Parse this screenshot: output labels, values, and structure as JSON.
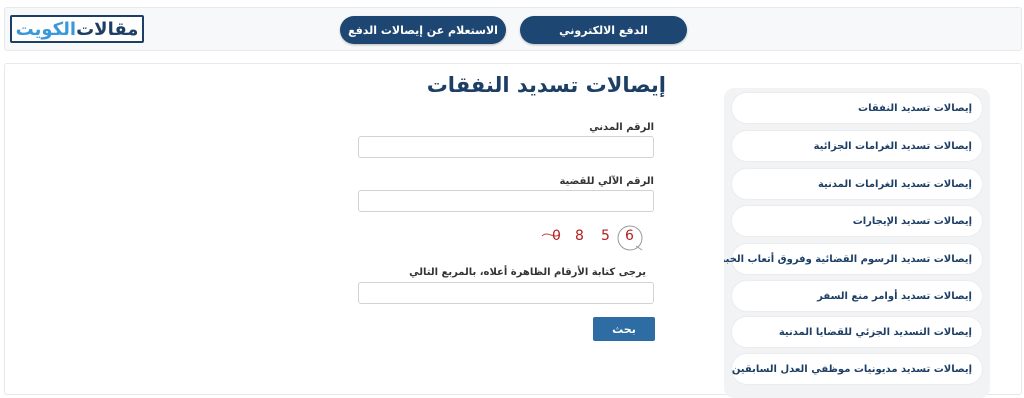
{
  "logo": {
    "part1": "مقالات",
    "part2": "الكويت"
  },
  "top_nav": {
    "inquiry_label": "الاستعلام عن إيصالات الدفع",
    "payment_label": "الدفع الالكتروني"
  },
  "sidebar": {
    "items": [
      {
        "label": "إيصالات تسديد النفقات"
      },
      {
        "label": "إيصالات تسديد الغرامات الجزائية"
      },
      {
        "label": "إيصالات تسديد الغرامات المدنية"
      },
      {
        "label": "إيصالات تسديد الإيجارات"
      },
      {
        "label": "إيصالات تسديد الرسوم القضائية وفروق أتعاب الخبرة"
      },
      {
        "label": "إيصالات تسديد أوامر منع السفر"
      },
      {
        "label": "إيصالات التسديد الجزئي للقضايا المدنية"
      },
      {
        "label": "إيصالات تسديد مديونيات موظفي العدل السابقين"
      }
    ]
  },
  "form": {
    "title": "إيصالات تسديد النفقات",
    "civil_id_label": "الرقم المدني",
    "civil_id_value": "",
    "case_number_label": "الرقم الآلي للقضية",
    "case_number_value": "",
    "captcha_digits": [
      "0",
      "8",
      "5",
      "6"
    ],
    "captcha_instruction": "يرجى كتابة الأرقام الظاهرة أعلاه، بالمربع التالي",
    "captcha_value": "",
    "search_label": "بحث"
  },
  "colors": {
    "brand_navy": "#1d4673",
    "button_blue": "#2d6da3",
    "captcha_red": "#b32020"
  }
}
